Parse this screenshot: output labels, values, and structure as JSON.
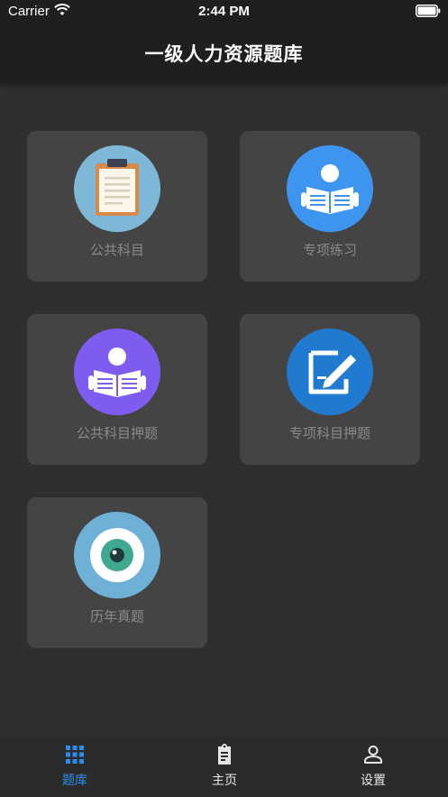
{
  "status_bar": {
    "carrier": "Carrier",
    "time": "2:44 PM"
  },
  "nav": {
    "title": "一级人力资源题库"
  },
  "cards": [
    {
      "label": "公共科目",
      "icon": "clipboard-icon",
      "color": "#7eb8d6"
    },
    {
      "label": "专项练习",
      "icon": "reading-person-icon",
      "color": "#3d95f0"
    },
    {
      "label": "公共科目押题",
      "icon": "reading-person-icon",
      "color": "#7e5cf0"
    },
    {
      "label": "专项科目押题",
      "icon": "edit-note-icon",
      "color": "#1f7ad0"
    },
    {
      "label": "历年真题",
      "icon": "eye-icon",
      "color": "#6fb0d6"
    }
  ],
  "tabs": [
    {
      "label": "题库",
      "icon": "grid-icon",
      "active": true
    },
    {
      "label": "主页",
      "icon": "clipboard-icon",
      "active": false
    },
    {
      "label": "设置",
      "icon": "user-icon",
      "active": false
    }
  ],
  "colors": {
    "background": "#2f2f2f",
    "bar": "#1f1f1f",
    "card": "#444444",
    "accent": "#2b8ef0"
  }
}
